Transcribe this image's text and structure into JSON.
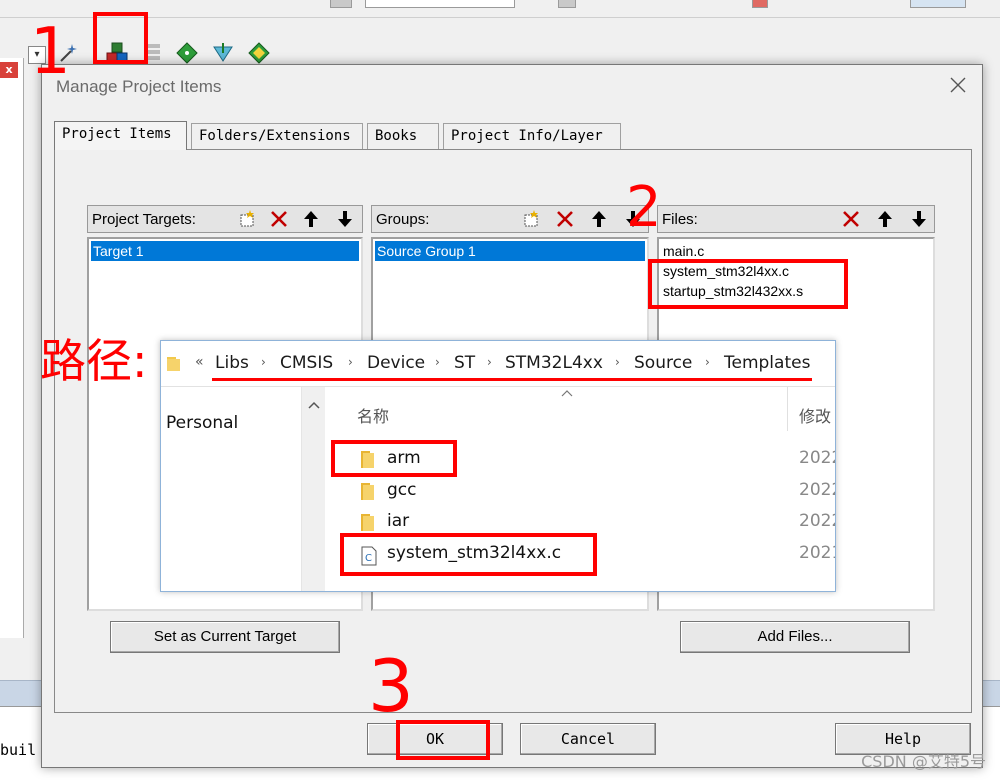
{
  "ide": {
    "build_output_text": "buil"
  },
  "dialog": {
    "title": "Manage Project Items",
    "tabs": [
      {
        "label": "Project Items"
      },
      {
        "label": "Folders/Extensions"
      },
      {
        "label": "Books"
      },
      {
        "label": "Project Info/Layer"
      }
    ],
    "targets": {
      "header": "Project Targets:",
      "items": [
        "Target 1"
      ]
    },
    "groups": {
      "header": "Groups:",
      "items": [
        "Source Group 1"
      ]
    },
    "files": {
      "header": "Files:",
      "items": [
        "main.c",
        "system_stm32l4xx.c",
        "startup_stm32l432xx.s"
      ]
    },
    "buttons": {
      "set_current_target": "Set as Current Target",
      "add_files": "Add Files...",
      "ok": "OK",
      "cancel": "Cancel",
      "help": "Help"
    }
  },
  "explorer": {
    "breadcrumb_prefix": "«",
    "breadcrumb": [
      "Libs",
      "CMSIS",
      "Device",
      "ST",
      "STM32L4xx",
      "Source",
      "Templates"
    ],
    "nav_item": "Personal",
    "columns": {
      "name": "名称",
      "modified": "修改"
    },
    "rows": [
      {
        "name": "arm",
        "type": "folder",
        "date": "2022"
      },
      {
        "name": "gcc",
        "type": "folder",
        "date": "2022"
      },
      {
        "name": "iar",
        "type": "folder",
        "date": "2022"
      },
      {
        "name": "system_stm32l4xx.c",
        "type": "c-file",
        "date": "2021"
      }
    ]
  },
  "annotations": {
    "step1": "1",
    "step2": "2",
    "step3": "3",
    "path_label": "路径:"
  },
  "watermark": "CSDN @艾特5号",
  "colors": {
    "annotation_red": "#ff0000",
    "selection_blue": "#0078d7"
  }
}
